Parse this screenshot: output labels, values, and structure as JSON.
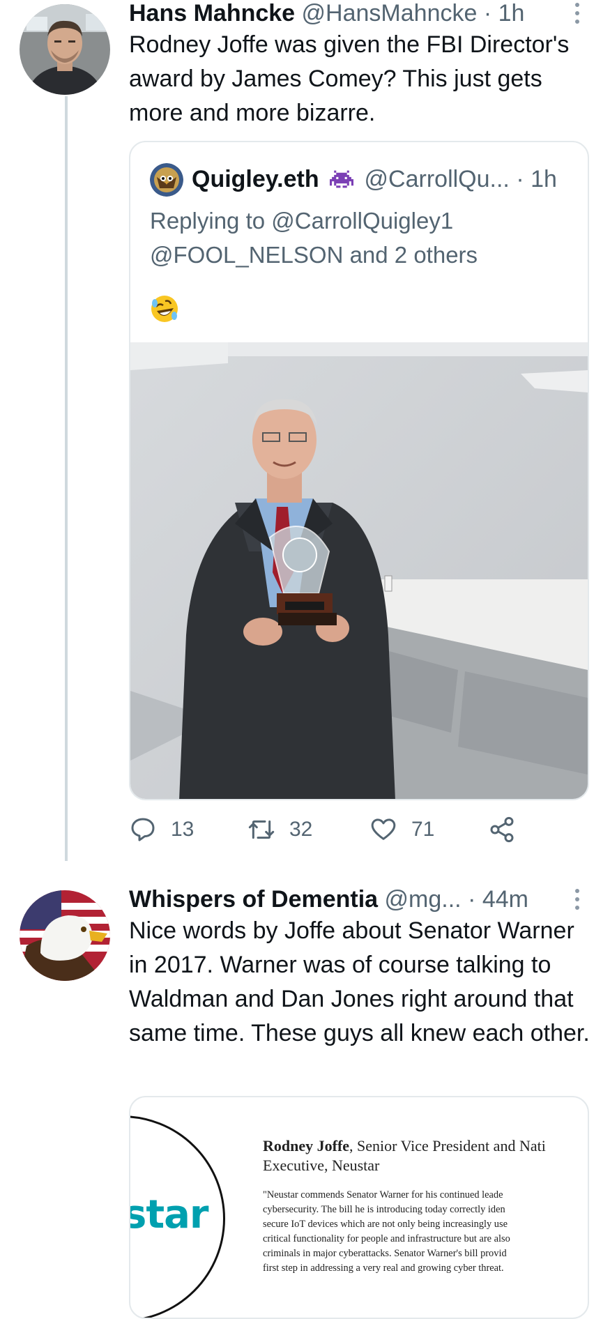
{
  "tweet1": {
    "name": "Hans Mahncke",
    "handle": "@HansMahncke",
    "separator": "·",
    "time": "1h",
    "text": "Rodney Joffe was given the FBI Director's award by James Comey? This just gets more and more bizarre.",
    "quote": {
      "name": "Quigley.eth",
      "handle": "@CarrollQu...",
      "time": "· 1h",
      "reply_line1": "Replying to @CarrollQuigley1",
      "reply_line2": "@FOOL_NELSON and 2 others",
      "emoji": "rolling-on-floor-laughing-emoji"
    },
    "actions": {
      "replies": "13",
      "retweets": "32",
      "likes": "71"
    }
  },
  "tweet2": {
    "name": "Whispers of Dementia",
    "handle": "@mg...",
    "time": "· 44m",
    "text": "Nice words by Joffe about Senator Warner in 2017. Warner was of course talking to Waldman and Dan Jones right around that same time.  These guys all knew each other.",
    "card": {
      "logo_text": "star",
      "person_name": "Rodney Joffe",
      "title_line1": ", Senior Vice President and Nati",
      "title_line2": "Executive, Neustar",
      "quote_lines": [
        "\"Neustar commends Senator Warner for his continued leade",
        "cybersecurity.  The bill he is introducing today correctly iden",
        "secure IoT devices which are not only being increasingly use",
        "critical functionality for people and infrastructure but are also",
        "criminals in major cyberattacks.  Senator Warner's bill provid",
        "first step in addressing a very real and growing cyber threat."
      ]
    }
  },
  "colors": {
    "text": "#0f1419",
    "secondary": "#536471",
    "border": "#e4e9ec",
    "thread_line": "#cfd9de",
    "neustar_teal": "#00a0af"
  }
}
